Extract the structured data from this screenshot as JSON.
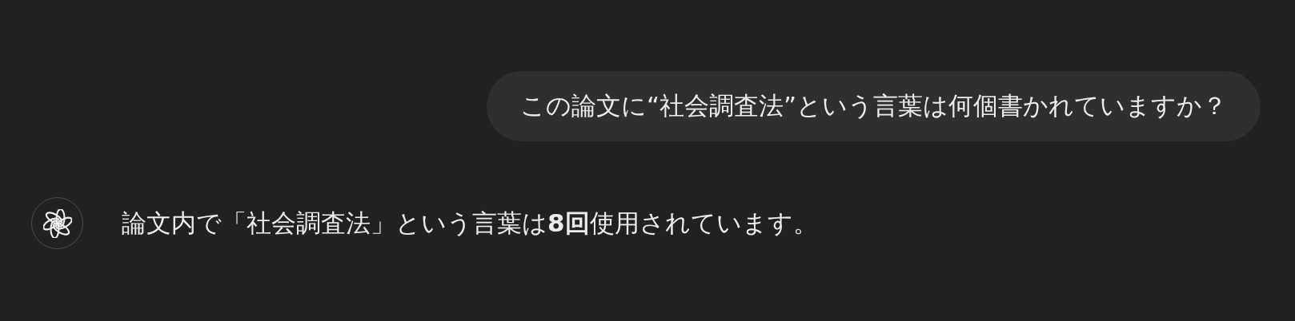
{
  "messages": [
    {
      "kind": "user",
      "text": "この論文に“社会調査法”という言葉は何個書かれていますか？"
    },
    {
      "kind": "assistant",
      "text": "論文内で「社会調査法」という言葉は**8回**使用されています。"
    }
  ]
}
